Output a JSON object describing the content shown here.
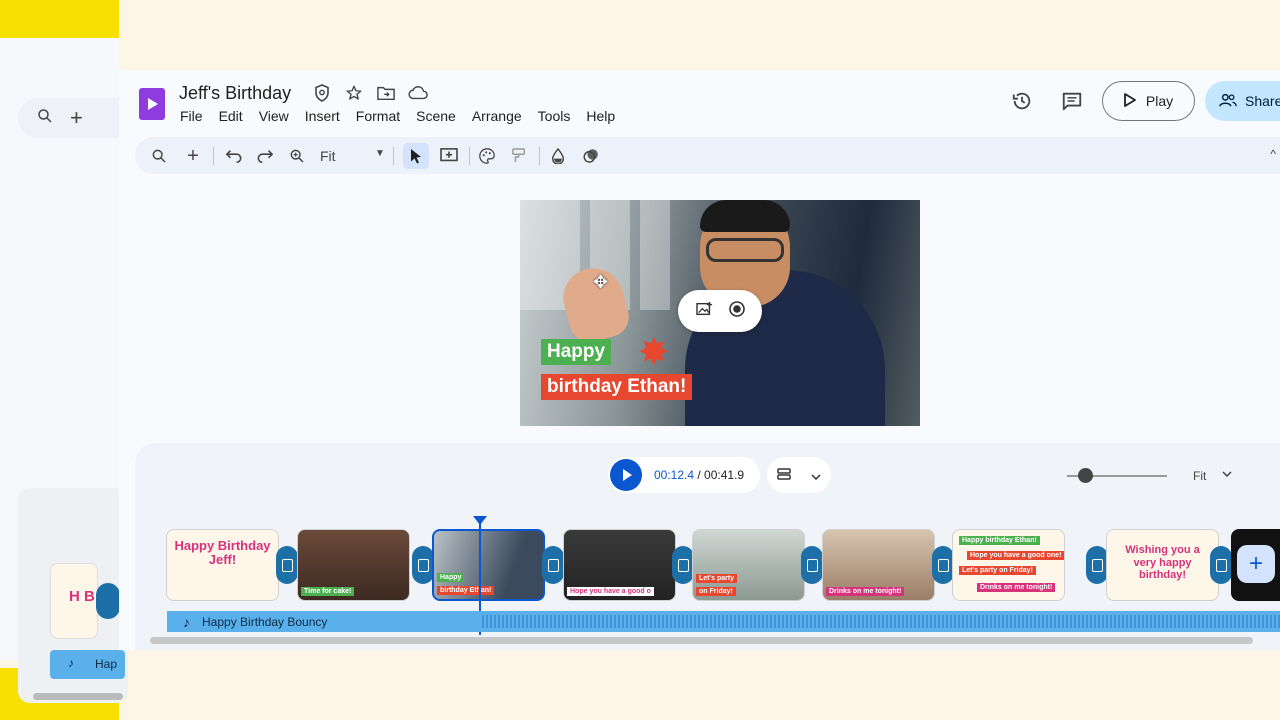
{
  "document": {
    "title": "Jeff's Birthday"
  },
  "menu": [
    "File",
    "Edit",
    "View",
    "Insert",
    "Format",
    "Scene",
    "Arrange",
    "Tools",
    "Help"
  ],
  "header": {
    "play_label": "Play",
    "share_label": "Share"
  },
  "toolbar": {
    "zoom_value": "Fit"
  },
  "canvas": {
    "line1": "Happy",
    "line2": "birthday Ethan!"
  },
  "timeline": {
    "current_time": "00:12.4",
    "total_time": "/ 00:41.9",
    "zoom_label": "Fit",
    "zoom_level": 0.15,
    "clips": [
      {
        "title": "Happy Birthday Jeff!"
      },
      {
        "caption": "Time for cake!"
      },
      {
        "caption1": "Happy",
        "caption2": "birthday Ethan!"
      },
      {
        "caption": "Hope you have a good o"
      },
      {
        "caption1": "Let's party",
        "caption2": "on Friday!"
      },
      {
        "caption": "Drinks on me tonight!"
      },
      {
        "lines": [
          "Happy birthday Ethan!",
          "Hope you have a good one!",
          "Let's party on Friday!",
          "Drinks on me tonight!"
        ]
      },
      {
        "title": "Wishing you a very happy birthday!"
      }
    ],
    "audio_track": "Happy Birthday Bouncy"
  },
  "ghost": {
    "clip_text": "H B",
    "audio_text": "Hap"
  },
  "colors": {
    "accent": "#0b57d0",
    "brand": "#8e3ce0",
    "share_bg": "#c2e7ff",
    "audio_track": "#5ab0ea"
  }
}
